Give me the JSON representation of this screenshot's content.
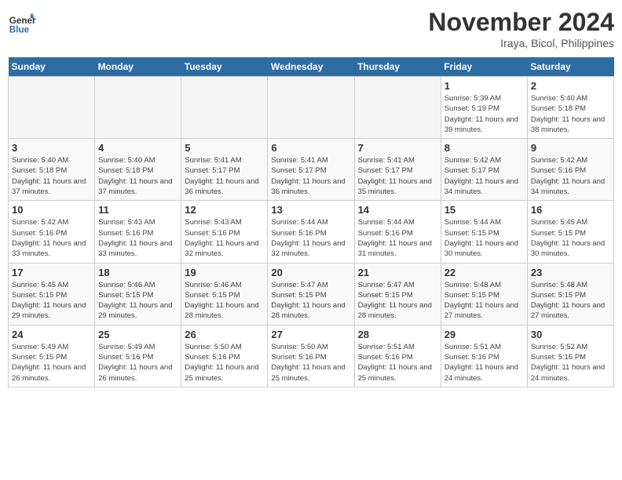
{
  "header": {
    "logo_line1": "General",
    "logo_line2": "Blue",
    "month": "November 2024",
    "location": "Iraya, Bicol, Philippines"
  },
  "days_of_week": [
    "Sunday",
    "Monday",
    "Tuesday",
    "Wednesday",
    "Thursday",
    "Friday",
    "Saturday"
  ],
  "weeks": [
    [
      {
        "day": "",
        "empty": true
      },
      {
        "day": "",
        "empty": true
      },
      {
        "day": "",
        "empty": true
      },
      {
        "day": "",
        "empty": true
      },
      {
        "day": "",
        "empty": true
      },
      {
        "day": "1",
        "sunrise": "Sunrise: 5:39 AM",
        "sunset": "Sunset: 5:19 PM",
        "daylight": "Daylight: 11 hours and 39 minutes."
      },
      {
        "day": "2",
        "sunrise": "Sunrise: 5:40 AM",
        "sunset": "Sunset: 5:18 PM",
        "daylight": "Daylight: 11 hours and 38 minutes."
      }
    ],
    [
      {
        "day": "3",
        "sunrise": "Sunrise: 5:40 AM",
        "sunset": "Sunset: 5:18 PM",
        "daylight": "Daylight: 11 hours and 37 minutes."
      },
      {
        "day": "4",
        "sunrise": "Sunrise: 5:40 AM",
        "sunset": "Sunset: 5:18 PM",
        "daylight": "Daylight: 11 hours and 37 minutes."
      },
      {
        "day": "5",
        "sunrise": "Sunrise: 5:41 AM",
        "sunset": "Sunset: 5:17 PM",
        "daylight": "Daylight: 11 hours and 36 minutes."
      },
      {
        "day": "6",
        "sunrise": "Sunrise: 5:41 AM",
        "sunset": "Sunset: 5:17 PM",
        "daylight": "Daylight: 11 hours and 36 minutes."
      },
      {
        "day": "7",
        "sunrise": "Sunrise: 5:41 AM",
        "sunset": "Sunset: 5:17 PM",
        "daylight": "Daylight: 11 hours and 35 minutes."
      },
      {
        "day": "8",
        "sunrise": "Sunrise: 5:42 AM",
        "sunset": "Sunset: 5:17 PM",
        "daylight": "Daylight: 11 hours and 34 minutes."
      },
      {
        "day": "9",
        "sunrise": "Sunrise: 5:42 AM",
        "sunset": "Sunset: 5:16 PM",
        "daylight": "Daylight: 11 hours and 34 minutes."
      }
    ],
    [
      {
        "day": "10",
        "sunrise": "Sunrise: 5:42 AM",
        "sunset": "Sunset: 5:16 PM",
        "daylight": "Daylight: 11 hours and 33 minutes."
      },
      {
        "day": "11",
        "sunrise": "Sunrise: 5:43 AM",
        "sunset": "Sunset: 5:16 PM",
        "daylight": "Daylight: 11 hours and 33 minutes."
      },
      {
        "day": "12",
        "sunrise": "Sunrise: 5:43 AM",
        "sunset": "Sunset: 5:16 PM",
        "daylight": "Daylight: 11 hours and 32 minutes."
      },
      {
        "day": "13",
        "sunrise": "Sunrise: 5:44 AM",
        "sunset": "Sunset: 5:16 PM",
        "daylight": "Daylight: 11 hours and 32 minutes."
      },
      {
        "day": "14",
        "sunrise": "Sunrise: 5:44 AM",
        "sunset": "Sunset: 5:16 PM",
        "daylight": "Daylight: 11 hours and 31 minutes."
      },
      {
        "day": "15",
        "sunrise": "Sunrise: 5:44 AM",
        "sunset": "Sunset: 5:15 PM",
        "daylight": "Daylight: 11 hours and 30 minutes."
      },
      {
        "day": "16",
        "sunrise": "Sunrise: 5:45 AM",
        "sunset": "Sunset: 5:15 PM",
        "daylight": "Daylight: 11 hours and 30 minutes."
      }
    ],
    [
      {
        "day": "17",
        "sunrise": "Sunrise: 5:45 AM",
        "sunset": "Sunset: 5:15 PM",
        "daylight": "Daylight: 11 hours and 29 minutes."
      },
      {
        "day": "18",
        "sunrise": "Sunrise: 5:46 AM",
        "sunset": "Sunset: 5:15 PM",
        "daylight": "Daylight: 11 hours and 29 minutes."
      },
      {
        "day": "19",
        "sunrise": "Sunrise: 5:46 AM",
        "sunset": "Sunset: 5:15 PM",
        "daylight": "Daylight: 11 hours and 28 minutes."
      },
      {
        "day": "20",
        "sunrise": "Sunrise: 5:47 AM",
        "sunset": "Sunset: 5:15 PM",
        "daylight": "Daylight: 11 hours and 28 minutes."
      },
      {
        "day": "21",
        "sunrise": "Sunrise: 5:47 AM",
        "sunset": "Sunset: 5:15 PM",
        "daylight": "Daylight: 11 hours and 28 minutes."
      },
      {
        "day": "22",
        "sunrise": "Sunrise: 5:48 AM",
        "sunset": "Sunset: 5:15 PM",
        "daylight": "Daylight: 11 hours and 27 minutes."
      },
      {
        "day": "23",
        "sunrise": "Sunrise: 5:48 AM",
        "sunset": "Sunset: 5:15 PM",
        "daylight": "Daylight: 11 hours and 27 minutes."
      }
    ],
    [
      {
        "day": "24",
        "sunrise": "Sunrise: 5:49 AM",
        "sunset": "Sunset: 5:15 PM",
        "daylight": "Daylight: 11 hours and 26 minutes."
      },
      {
        "day": "25",
        "sunrise": "Sunrise: 5:49 AM",
        "sunset": "Sunset: 5:16 PM",
        "daylight": "Daylight: 11 hours and 26 minutes."
      },
      {
        "day": "26",
        "sunrise": "Sunrise: 5:50 AM",
        "sunset": "Sunset: 5:16 PM",
        "daylight": "Daylight: 11 hours and 25 minutes."
      },
      {
        "day": "27",
        "sunrise": "Sunrise: 5:50 AM",
        "sunset": "Sunset: 5:16 PM",
        "daylight": "Daylight: 11 hours and 25 minutes."
      },
      {
        "day": "28",
        "sunrise": "Sunrise: 5:51 AM",
        "sunset": "Sunset: 5:16 PM",
        "daylight": "Daylight: 11 hours and 25 minutes."
      },
      {
        "day": "29",
        "sunrise": "Sunrise: 5:51 AM",
        "sunset": "Sunset: 5:16 PM",
        "daylight": "Daylight: 11 hours and 24 minutes."
      },
      {
        "day": "30",
        "sunrise": "Sunrise: 5:52 AM",
        "sunset": "Sunset: 5:16 PM",
        "daylight": "Daylight: 11 hours and 24 minutes."
      }
    ]
  ]
}
